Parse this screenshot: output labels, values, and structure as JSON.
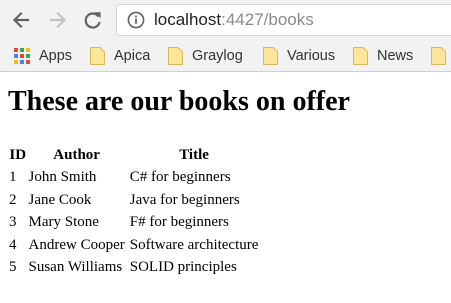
{
  "browser": {
    "url_host": "localhost",
    "url_rest": ":4427/books",
    "bookmarks": [
      {
        "label": "Apps",
        "icon": "apps-grid-icon"
      },
      {
        "label": "Apica",
        "icon": "folder-icon"
      },
      {
        "label": "Graylog",
        "icon": "folder-icon"
      },
      {
        "label": "Various",
        "icon": "folder-icon"
      },
      {
        "label": "News",
        "icon": "folder-icon"
      }
    ]
  },
  "page": {
    "heading": "These are our books on offer",
    "table": {
      "headers": [
        "ID",
        "Author",
        "Title"
      ],
      "rows": [
        [
          "1",
          "John Smith",
          "C# for beginners"
        ],
        [
          "2",
          "Jane Cook",
          "Java for beginners"
        ],
        [
          "3",
          "Mary Stone",
          "F# for beginners"
        ],
        [
          "4",
          "Andrew Cooper",
          "Software architecture"
        ],
        [
          "5",
          "Susan Williams",
          "SOLID principles"
        ]
      ]
    }
  }
}
